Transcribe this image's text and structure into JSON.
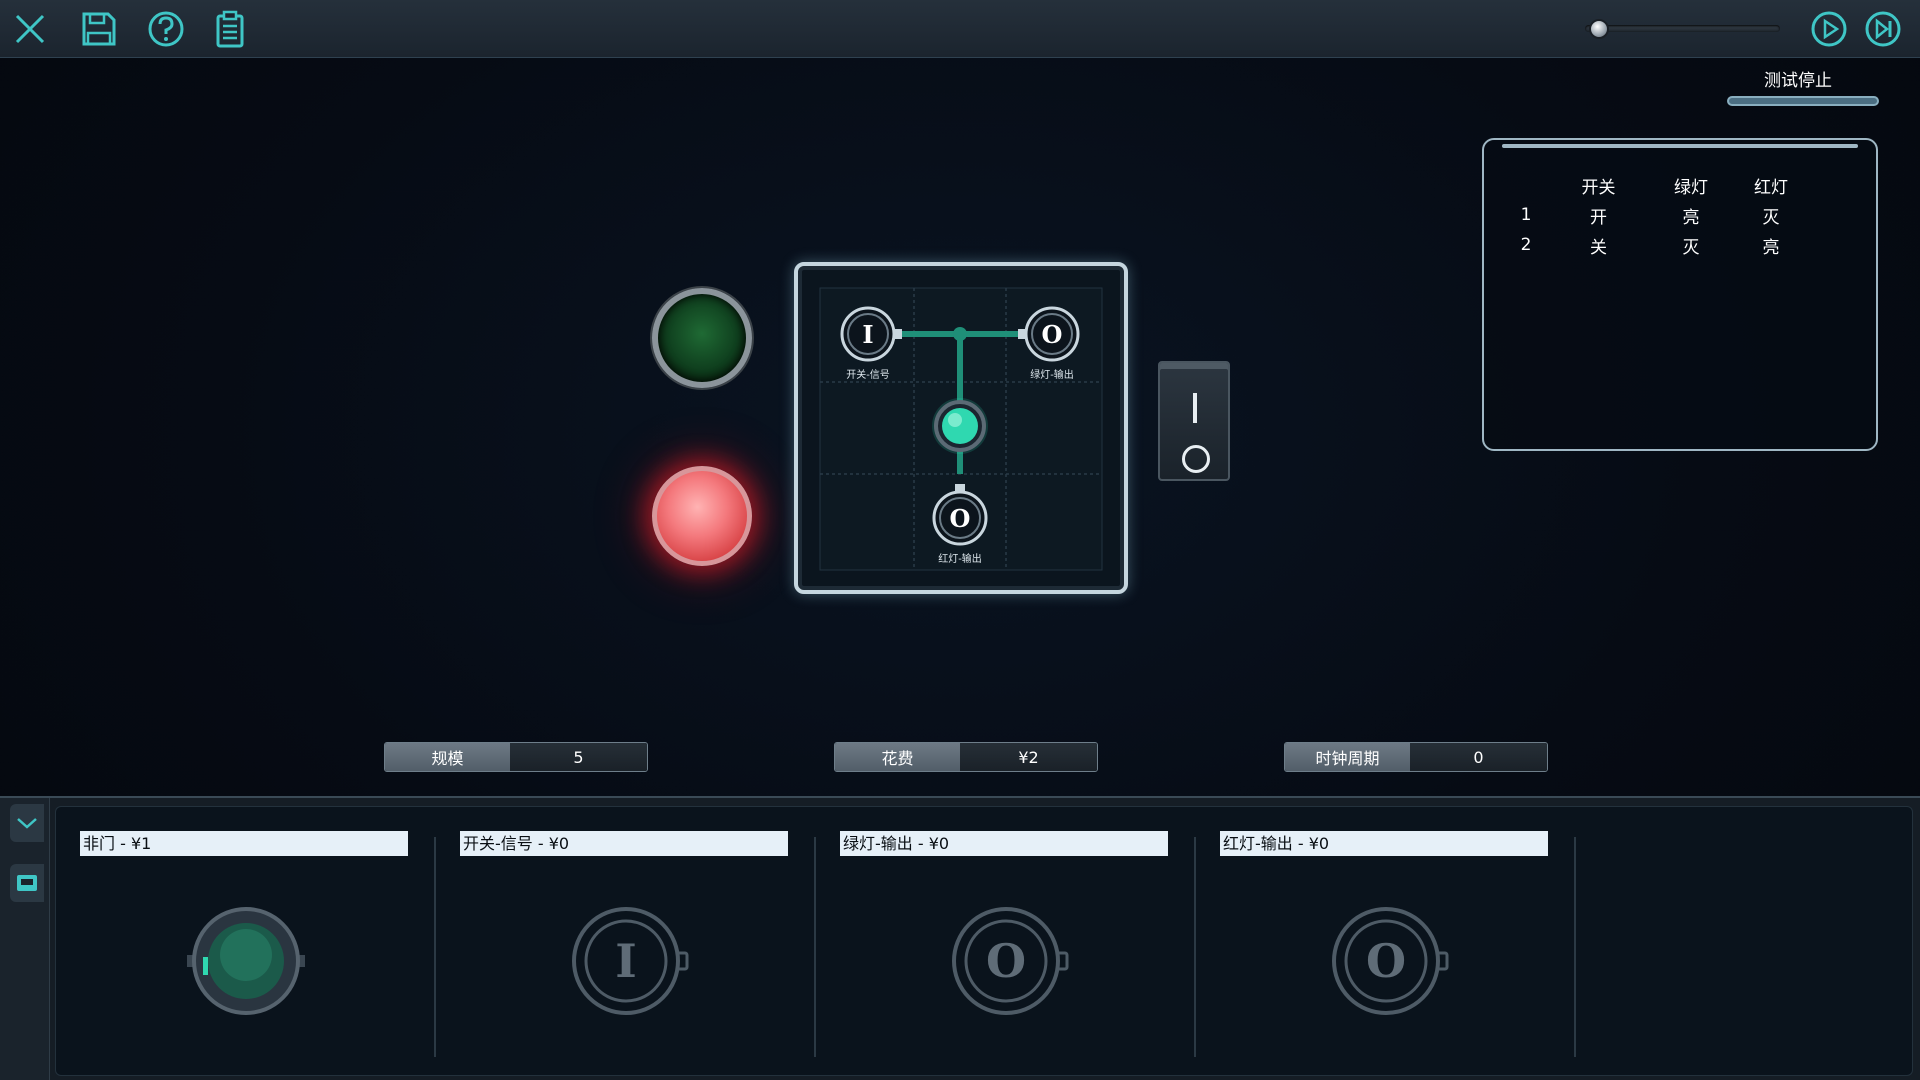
{
  "toolbar": {
    "icons": [
      "close-icon",
      "save-icon",
      "help-icon",
      "clipboard-icon"
    ],
    "speed_value": 0.02,
    "right_icons": [
      "play-icon",
      "step-forward-icon"
    ]
  },
  "test": {
    "status": "测试停止"
  },
  "truth_table": {
    "headers": [
      "",
      "开关",
      "绿灯",
      "红灯"
    ],
    "rows": [
      [
        "1",
        "开",
        "亮",
        "灭"
      ],
      [
        "2",
        "关",
        "灭",
        "亮"
      ]
    ]
  },
  "lamps": {
    "green_state": "off",
    "red_state": "on"
  },
  "circuit": {
    "nodes": [
      {
        "symbol": "I",
        "label": "开关-信号"
      },
      {
        "symbol": "O",
        "label": "绿灯-输出"
      },
      {
        "symbol": "O",
        "label": "红灯-输出"
      }
    ]
  },
  "switch": {
    "on_symbol": "I",
    "off_symbol": "O"
  },
  "stats": {
    "scale_label": "规模",
    "scale_value": "5",
    "cost_label": "花费",
    "cost_value": "¥2",
    "clock_label": "时钟周期",
    "clock_value": "0"
  },
  "palette": {
    "items": [
      {
        "title": "非门 - ¥1",
        "icon": "not-gate-icon"
      },
      {
        "title": "开关-信号 - ¥0",
        "icon": "input-i-icon",
        "symbol": "I"
      },
      {
        "title": "绿灯-输出 - ¥0",
        "icon": "output-o-icon",
        "symbol": "O"
      },
      {
        "title": "红灯-输出 - ¥0",
        "icon": "output-o-icon",
        "symbol": "O"
      }
    ]
  },
  "colors": {
    "accent_teal": "#2fd8b0",
    "lamp_red": "#e8585c",
    "lamp_green_off": "#1c5e2f"
  }
}
